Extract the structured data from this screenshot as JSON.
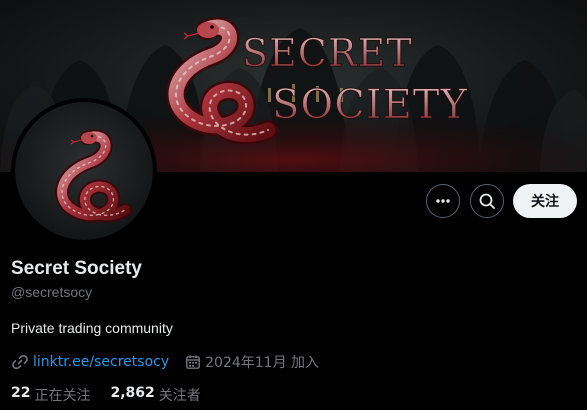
{
  "banner": {
    "logo_word_1": "SECRET",
    "logo_word_2": "SOCIETY"
  },
  "profile": {
    "display_name": "Secret Society",
    "handle": "@secretsocy",
    "bio": "Private trading community",
    "link": "linktr.ee/secretsocy",
    "joined": "2024年11月 加入"
  },
  "actions": {
    "more_icon": "more-icon",
    "search_icon": "search-icon",
    "follow_label": "关注"
  },
  "stats": {
    "following_count": "22",
    "following_label": "正在关注",
    "followers_count": "2,862",
    "followers_label": "关注者"
  },
  "colors": {
    "link": "#1d9bf0",
    "muted": "#71767b",
    "text": "#e7e9ea",
    "follow_bg": "#eff3f4",
    "snake_red": "#8b1e24"
  }
}
